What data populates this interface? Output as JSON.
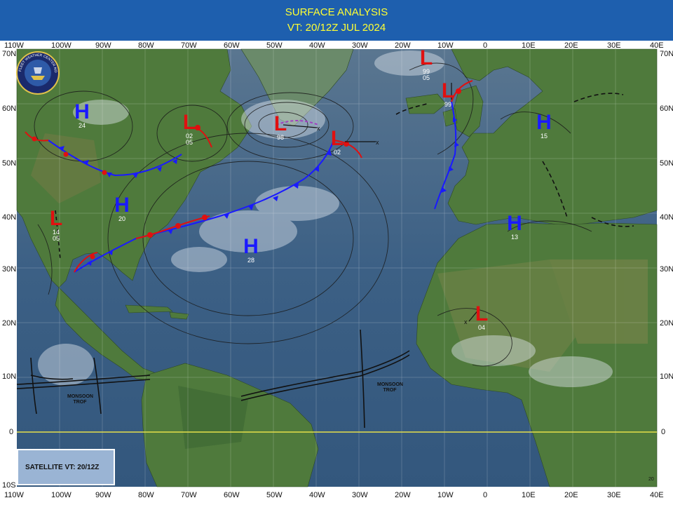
{
  "header": {
    "title": "SURFACE ANALYSIS",
    "valid_time": "VT: 20/12Z JUL 2024"
  },
  "longitude_labels": [
    "110W",
    "100W",
    "90W",
    "80W",
    "70W",
    "60W",
    "50W",
    "40W",
    "30W",
    "20W",
    "10W",
    "0",
    "10E",
    "20E",
    "30E",
    "40E"
  ],
  "latitude_labels": [
    "70N",
    "60N",
    "50N",
    "40N",
    "30N",
    "20N",
    "10N",
    "0",
    "10S"
  ],
  "logo_text": "FLEET WEATHER CENTER NORFOLK",
  "satellite_box": "SATELLITE VT: 20/12Z",
  "corner_mark": "20",
  "systems": [
    {
      "type": "H",
      "label": "24"
    },
    {
      "type": "L",
      "label": "02 05"
    },
    {
      "type": "L",
      "label": "98"
    },
    {
      "type": "L",
      "label": "02"
    },
    {
      "type": "L",
      "label": "99 05"
    },
    {
      "type": "L",
      "label": "99"
    },
    {
      "type": "H",
      "label": "15"
    },
    {
      "type": "H",
      "label": "20"
    },
    {
      "type": "L",
      "label": "14 05"
    },
    {
      "type": "H",
      "label": "28"
    },
    {
      "type": "H",
      "label": "13"
    },
    {
      "type": "L",
      "label": "04"
    }
  ],
  "troughs": [
    {
      "label": "MONSOON TROF"
    },
    {
      "label": "MONSOON TROF"
    }
  ],
  "colors": {
    "header_bg": "#1e5fae",
    "header_text": "#ffff33",
    "high": "#1a1aff",
    "low": "#e01010",
    "ocean": "#3b5f85",
    "land": "#4f7a3c",
    "equator": "#e6e04a",
    "satellite_box": "#9ab4d4"
  }
}
